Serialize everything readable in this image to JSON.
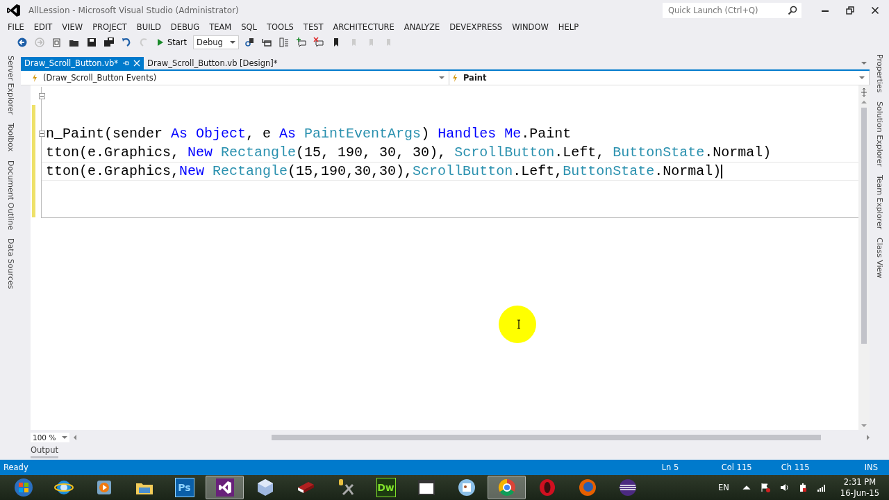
{
  "window": {
    "title": "AllLession - Microsoft Visual Studio (Administrator)"
  },
  "quick_launch": {
    "placeholder": "Quick Launch (Ctrl+Q)"
  },
  "menu": [
    "FILE",
    "EDIT",
    "VIEW",
    "PROJECT",
    "BUILD",
    "DEBUG",
    "TEAM",
    "SQL",
    "TOOLS",
    "TEST",
    "ARCHITECTURE",
    "ANALYZE",
    "DEVEXPRESS",
    "WINDOW",
    "HELP"
  ],
  "toolbar": {
    "start": "Start",
    "configuration": "Debug"
  },
  "left_tool_tabs": [
    "Server Explorer",
    "Toolbox",
    "Document Outline",
    "Data Sources"
  ],
  "right_tool_tabs": [
    "Properties",
    "Solution Explorer",
    "Team Explorer",
    "Class View"
  ],
  "document_tabs": [
    {
      "label": "Draw_Scroll_Button.vb*",
      "selected": true
    },
    {
      "label": "Draw_Scroll_Button.vb [Design]*",
      "selected": false
    }
  ],
  "navigation_bar": {
    "type_list": "(Draw_Scroll_Button Events)",
    "member_list": "Paint"
  },
  "editor": {
    "lines": [
      {
        "collapsible": true,
        "current": false
      },
      {
        "collapsible": false,
        "current": false
      },
      {
        "collapsible": true,
        "current": false,
        "tokens": [
          {
            "text": "n_Paint(sender ",
            "kind": "plain"
          },
          {
            "text": "As Object",
            "kind": "keyword"
          },
          {
            "text": ", e ",
            "kind": "plain"
          },
          {
            "text": "As ",
            "kind": "keyword"
          },
          {
            "text": "PaintEventArgs",
            "kind": "type"
          },
          {
            "text": ") ",
            "kind": "plain"
          },
          {
            "text": "Handles Me",
            "kind": "keyword"
          },
          {
            "text": ".Paint",
            "kind": "plain"
          }
        ]
      },
      {
        "collapsible": false,
        "current": false,
        "tokens": [
          {
            "text": "tton(e.Graphics, ",
            "kind": "plain"
          },
          {
            "text": "New ",
            "kind": "keyword"
          },
          {
            "text": "Rectangle",
            "kind": "type"
          },
          {
            "text": "(15, 190, 30, 30), ",
            "kind": "plain"
          },
          {
            "text": "ScrollButton",
            "kind": "type"
          },
          {
            "text": ".Left, ",
            "kind": "plain"
          },
          {
            "text": "ButtonState",
            "kind": "type"
          },
          {
            "text": ".Normal)",
            "kind": "plain"
          }
        ]
      },
      {
        "collapsible": false,
        "current": true,
        "tokens": [
          {
            "text": "tton(e.Graphics,",
            "kind": "plain"
          },
          {
            "text": "New ",
            "kind": "keyword"
          },
          {
            "text": "Rectangle",
            "kind": "type"
          },
          {
            "text": "(15,190,30,30),",
            "kind": "plain"
          },
          {
            "text": "ScrollButton",
            "kind": "type"
          },
          {
            "text": ".Left,",
            "kind": "plain"
          },
          {
            "text": "ButtonState",
            "kind": "type"
          },
          {
            "text": ".Normal)",
            "kind": "plain"
          }
        ]
      },
      {
        "collapsible": false,
        "current": false
      },
      {
        "collapsible": false,
        "current": false
      }
    ]
  },
  "zoom": "100 %",
  "bottom_tabs": [
    "Output"
  ],
  "status_bar": {
    "state": "Ready",
    "line": "Ln 5",
    "column": "Col 115",
    "character": "Ch 115",
    "mode": "INS"
  },
  "taskbar": {
    "apps": [
      {
        "kind": "start",
        "selected": false
      },
      {
        "kind": "ie",
        "selected": false
      },
      {
        "kind": "media",
        "selected": false
      },
      {
        "kind": "folder",
        "selected": false
      },
      {
        "kind": "tile",
        "label": "Ps",
        "selected": false
      },
      {
        "kind": "vs",
        "selected": true
      },
      {
        "kind": "cube",
        "selected": false
      },
      {
        "kind": "book",
        "selected": false
      },
      {
        "kind": "tools",
        "selected": false
      },
      {
        "kind": "tile_green",
        "label": "Dw",
        "selected": false
      },
      {
        "kind": "window",
        "selected": false
      },
      {
        "kind": "contact",
        "selected": false
      },
      {
        "kind": "chrome",
        "selected": true
      },
      {
        "kind": "opera",
        "selected": false
      },
      {
        "kind": "firefox",
        "selected": false
      },
      {
        "kind": "eclipse",
        "selected": false
      }
    ],
    "language": "EN",
    "time": "2:31 PM",
    "date": "16-Jun-15"
  }
}
